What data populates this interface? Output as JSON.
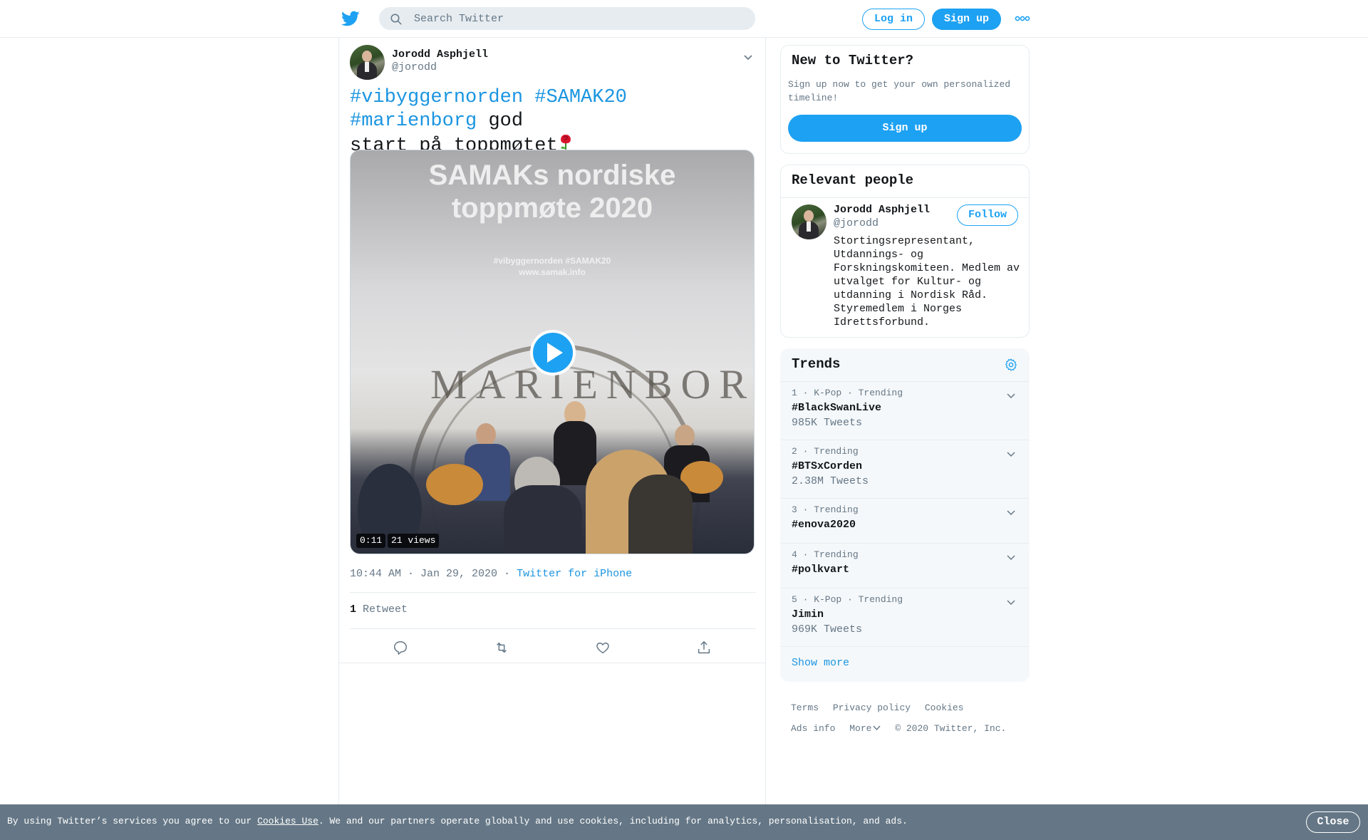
{
  "header": {
    "logo_icon": "twitter-bird-icon",
    "search_placeholder": "Search Twitter",
    "login_label": "Log in",
    "signup_label": "Sign up",
    "more_icon": "more-dots-icon"
  },
  "tweet": {
    "author_name": "Jorodd Asphjell",
    "author_handle": "@jorodd",
    "hashtags": [
      "#vibyggernorden",
      "#SAMAK20",
      "#marienborg"
    ],
    "text_rest_1": "god",
    "text_rest_2": "start på toppmøtet",
    "emoji_icon": "rose-icon",
    "media": {
      "screen_title_line1": "SAMAKs nordiske",
      "screen_title_line2": "toppmøte 2020",
      "screen_hashtags": "#vibyggernorden #SAMAK20",
      "screen_url": "www.samak.info",
      "seal_text": "MARIENBORG",
      "duration": "0:11",
      "views": "21 views",
      "play_icon": "play-icon"
    },
    "time": "10:44 AM · Jan 29, 2020",
    "separator": "·",
    "source": "Twitter for iPhone",
    "retweet_count": "1",
    "retweet_label": "Retweet",
    "actions": [
      "reply-icon",
      "retweet-icon",
      "like-icon",
      "share-icon"
    ]
  },
  "sidebar": {
    "new_to_twitter": {
      "title": "New to Twitter?",
      "description": "Sign up now to get your own personalized timeline!",
      "button": "Sign up"
    },
    "relevant_people": {
      "title": "Relevant people",
      "name": "Jorodd Asphjell",
      "handle": "@jorodd",
      "follow_label": "Follow",
      "bio": "Stortingsrepresentant, Utdannings- og Forskningskomiteen. Medlem av utvalget for Kultur- og utdanning i Nordisk Råd. Styremedlem i Norges Idrettsforbund."
    },
    "trends": {
      "title": "Trends",
      "items": [
        {
          "meta": "1 · K-Pop · Trending",
          "name": "#BlackSwanLive",
          "count": "985K Tweets"
        },
        {
          "meta": "2 · Trending",
          "name": "#BTSxCorden",
          "count": "2.38M Tweets"
        },
        {
          "meta": "3 · Trending",
          "name": "#enova2020",
          "count": ""
        },
        {
          "meta": "4 · Trending",
          "name": "#polkvart",
          "count": ""
        },
        {
          "meta": "5 · K-Pop · Trending",
          "name": "Jimin",
          "count": "969K Tweets"
        }
      ],
      "show_more": "Show more"
    },
    "footer": {
      "terms": "Terms",
      "privacy": "Privacy policy",
      "cookies": "Cookies",
      "ads_info": "Ads info",
      "more": "More",
      "copyright": "© 2020 Twitter, Inc."
    }
  },
  "cookie_bar": {
    "text_before": "By using Twitter’s services you agree to our ",
    "link": "Cookies Use",
    "text_after": ". We and our partners operate globally and use cookies, including for analytics, personalisation, and ads.",
    "close_label": "Close"
  },
  "colors": {
    "brand_blue": "#1da1f2",
    "link_blue": "#1b95e0",
    "secondary_text": "#657786",
    "border": "#e6ecf0"
  }
}
